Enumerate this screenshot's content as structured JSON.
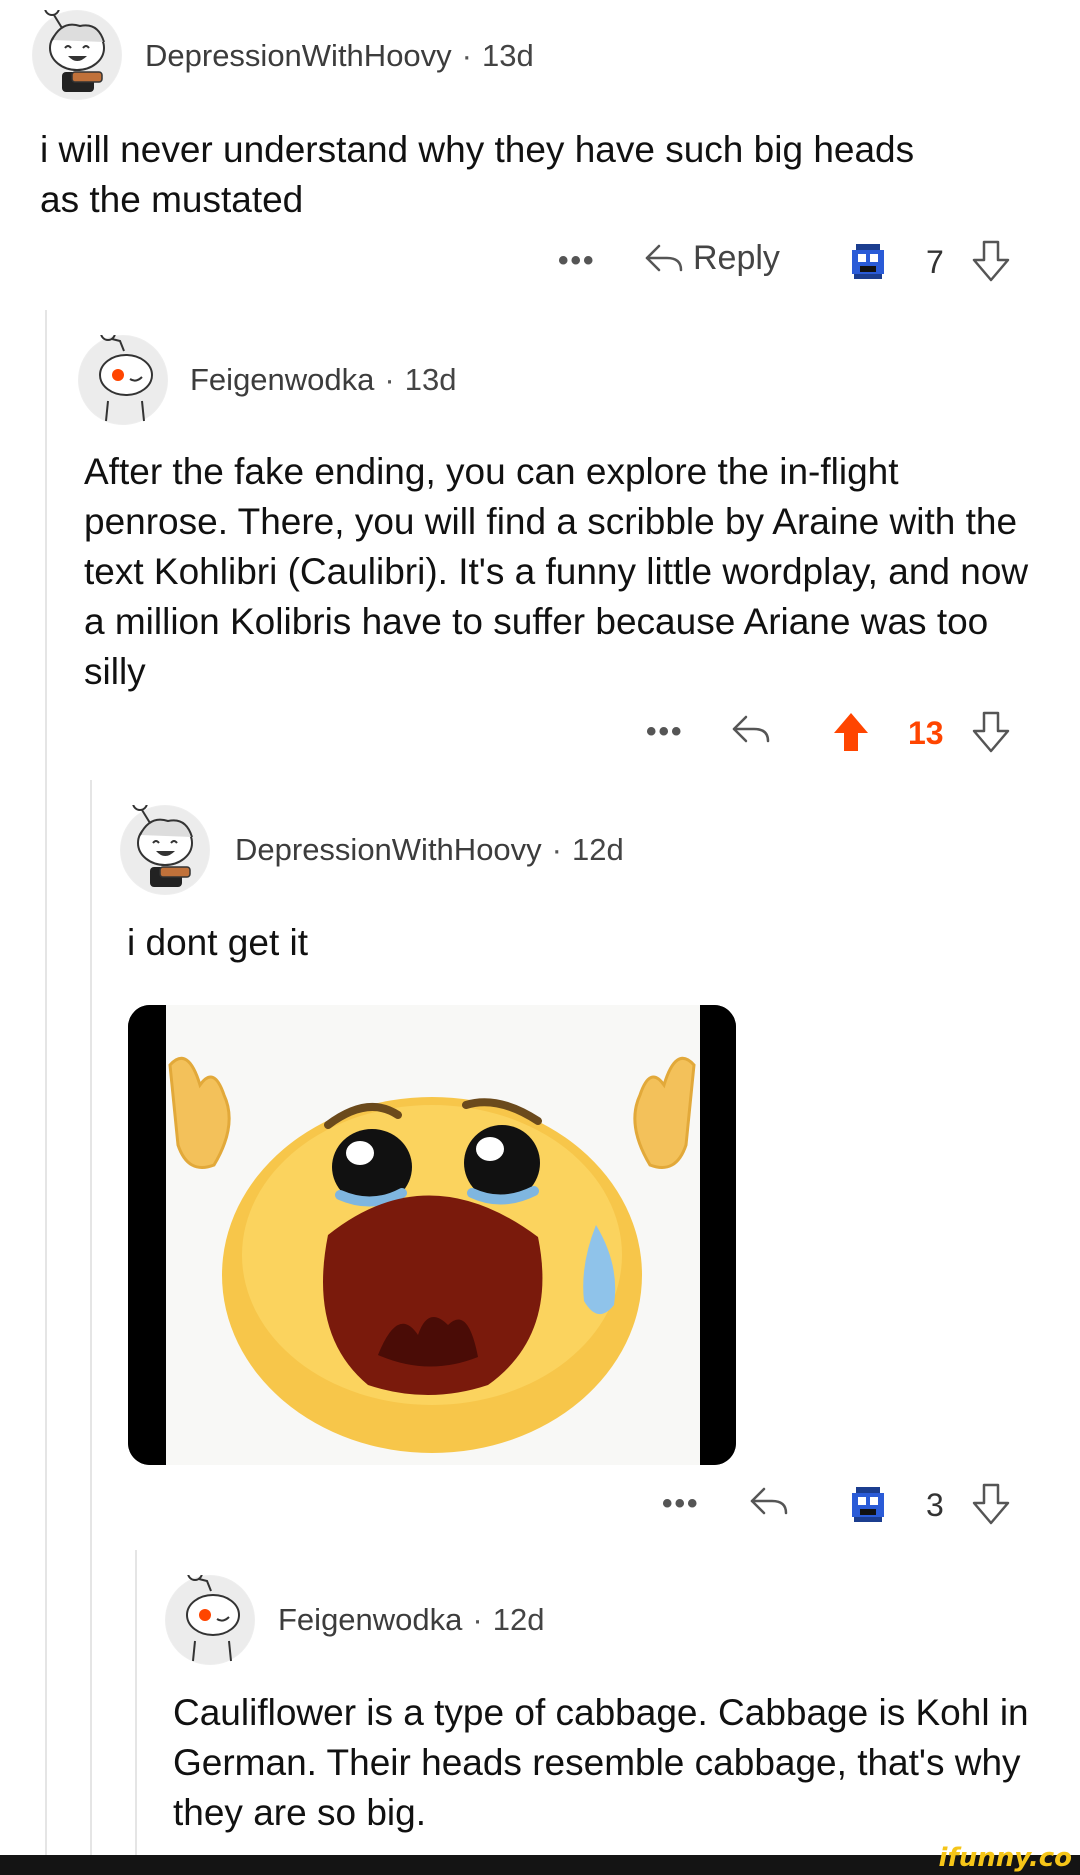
{
  "comments": [
    {
      "username": "DepressionWithHoovy",
      "age": "13d",
      "body": "i will never understand why they have such big heads as the mustated",
      "more_label": "•••",
      "reply_label": "Reply",
      "vote_count": "7",
      "avatar_icon": "snoo-avatar-hoovy-icon"
    },
    {
      "username": "Feigenwodka",
      "age": "13d",
      "body": "After the fake ending, you can explore the in-flight penrose. There, you will find a scribble by Araine with the text Kohlibri (Caulibri). It's a funny little wordplay, and now a million Kolibris have to suffer because Ariane was too silly",
      "more_label": "•••",
      "vote_count": "13",
      "upvoted": true,
      "avatar_icon": "snoo-avatar-default-icon"
    },
    {
      "username": "DepressionWithHoovy",
      "age": "12d",
      "body": "i dont get it",
      "more_label": "•••",
      "vote_count": "3",
      "avatar_icon": "snoo-avatar-hoovy-icon",
      "image_icon": "crying-emoji-meme-image"
    },
    {
      "username": "Feigenwodka",
      "age": "12d",
      "body": "Cauliflower is a type of cabbage. Cabbage is Kohl in German. Their heads resemble cabbage, that's why they are so big.",
      "avatar_icon": "snoo-avatar-default-icon"
    }
  ],
  "watermark": "ifunny.co",
  "colors": {
    "upvote_active": "#ff4500",
    "thread_line": "#e5e5e5",
    "award_blue": "#2a5bd7"
  }
}
